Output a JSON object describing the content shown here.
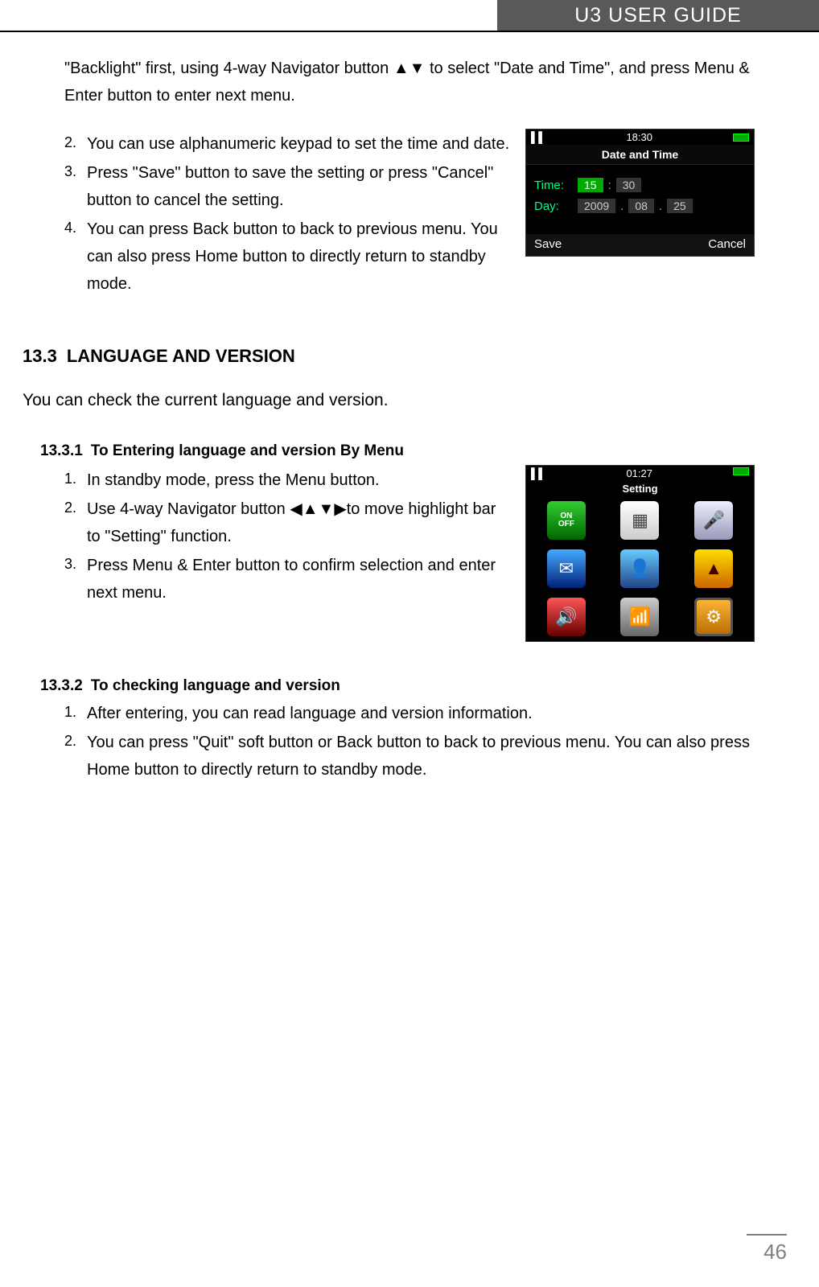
{
  "header": {
    "title": "U3 USER GUIDE"
  },
  "para1": "\"Backlight\" first, using 4-way Navigator button ▲▼ to select \"Date and Time\", and press Menu & Enter button to enter next menu.",
  "listA": {
    "i2": "You can use alphanumeric keypad to set the time and date.",
    "i3": "Press \"Save\" button to save the setting or press \"Cancel\" button to cancel the setting.",
    "i4": "You can press Back button to back to previous menu. You can also press Home button to directly return to standby mode."
  },
  "shot1": {
    "clock": "18:30",
    "title": "Date and Time",
    "timeLbl": "Time:",
    "hh": "15",
    "mm": "30",
    "dayLbl": "Day:",
    "yyyy": "2009",
    "mo": "08",
    "dd": "25",
    "save": "Save",
    "cancel": "Cancel"
  },
  "sec": {
    "num": "13.3",
    "title": "LANGUAGE AND VERSION"
  },
  "intro": "You can check the current language and version.",
  "sub1": {
    "num": "13.3.1",
    "title": "To Entering language and version By Menu"
  },
  "listB": {
    "i1": "In standby mode, press the Menu button.",
    "i2": "Use 4-way Navigator button ◀▲▼▶to move highlight bar to \"Setting\" function.",
    "i3": "Press Menu & Enter button to confirm selection and enter next menu."
  },
  "shot2": {
    "clock": "01:27",
    "title": "Setting",
    "on": "ON",
    "off": "OFF"
  },
  "sub2": {
    "num": "13.3.2",
    "title": "To checking language and version"
  },
  "listC": {
    "i1": "After entering, you can read language and version information.",
    "i2": "You can press \"Quit\" soft button or Back button to back to previous menu. You can also press Home button to directly return to standby mode."
  },
  "pageNum": "46"
}
